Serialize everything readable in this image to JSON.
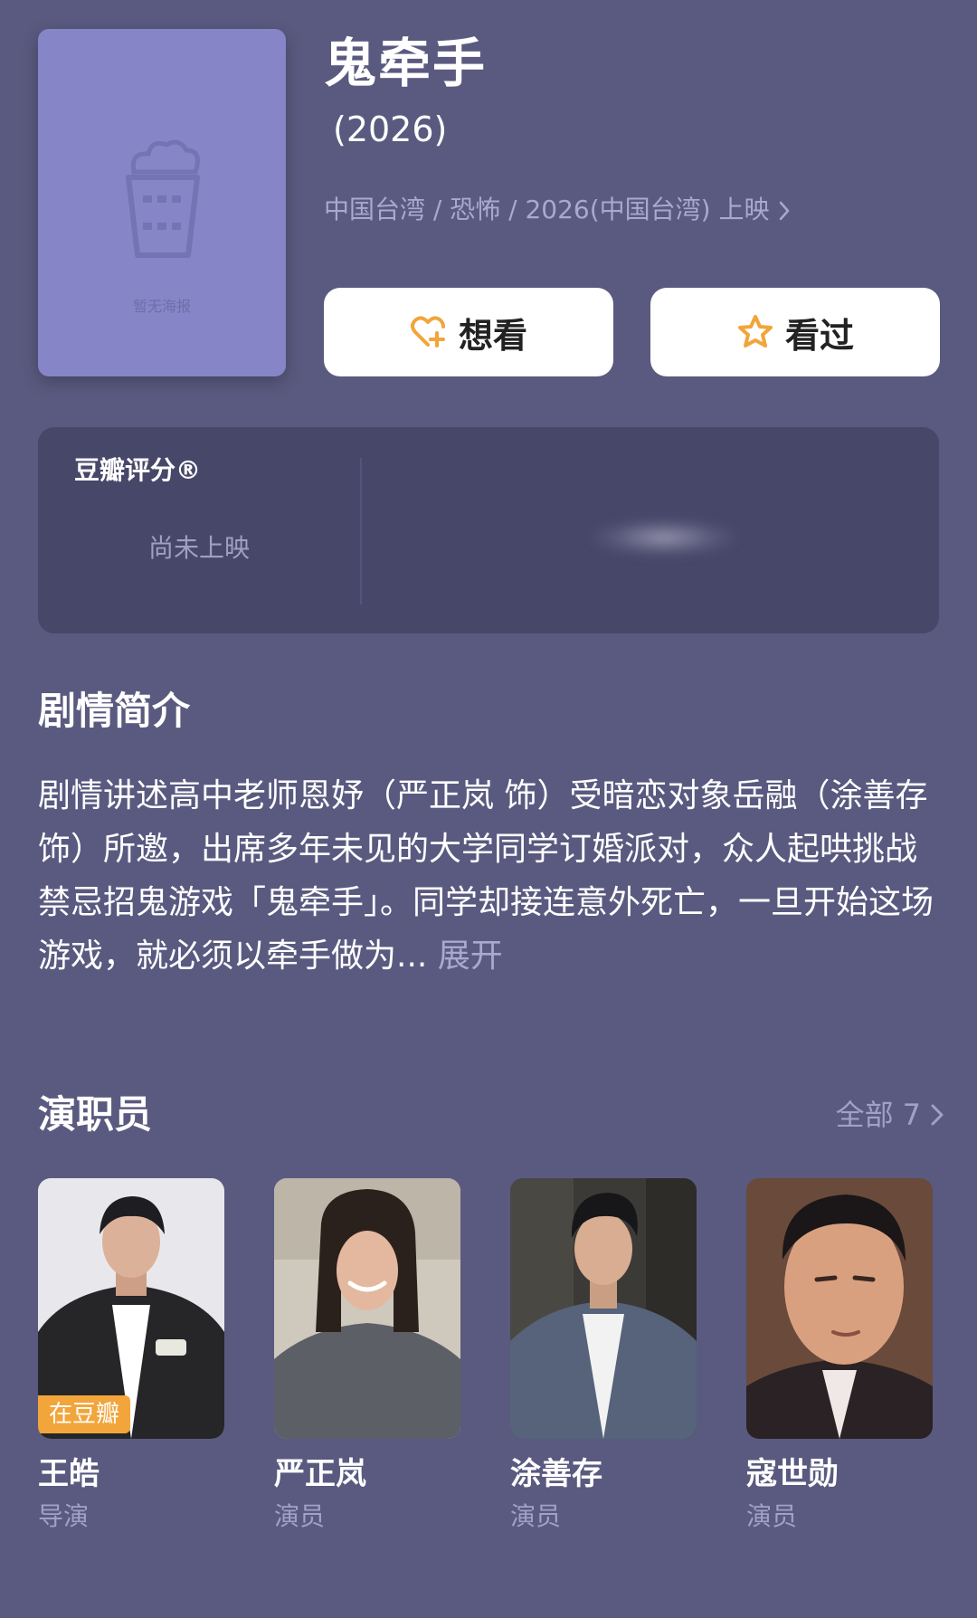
{
  "poster": {
    "caption": "暂无海报"
  },
  "movie": {
    "title": "鬼牵手",
    "year": "(2026)",
    "meta": "中国台湾 / 恐怖 / 2026(中国台湾) 上映"
  },
  "actions": {
    "want_label": "想看",
    "seen_label": "看过"
  },
  "rating": {
    "label": "豆瓣评分®",
    "status": "尚未上映"
  },
  "plot": {
    "title": "剧情简介",
    "text": "剧情讲述高中老师恩妤（严正岚 饰）受暗恋对象岳融（涂善存 饰）所邀，出席多年未见的大学同学订婚派对，众人起哄挑战禁忌招鬼游戏「鬼牵手」。同学却接连意外死亡，一旦开始这场游戏，就必须以牵手做为...",
    "expand_label": "展开"
  },
  "cast": {
    "title": "演职员",
    "all_label": "全部",
    "all_count": "7",
    "members": [
      {
        "name": "王皓",
        "role": "导演",
        "badge": "在豆瓣"
      },
      {
        "name": "严正岚",
        "role": "演员"
      },
      {
        "name": "涂善存",
        "role": "演员"
      },
      {
        "name": "寇世勋",
        "role": "演员"
      }
    ]
  },
  "colors": {
    "background": "#5a5a80",
    "card": "#474769",
    "poster": "#8585c8",
    "accent": "#f2a53a",
    "muted_text": "#a9a9cf"
  }
}
